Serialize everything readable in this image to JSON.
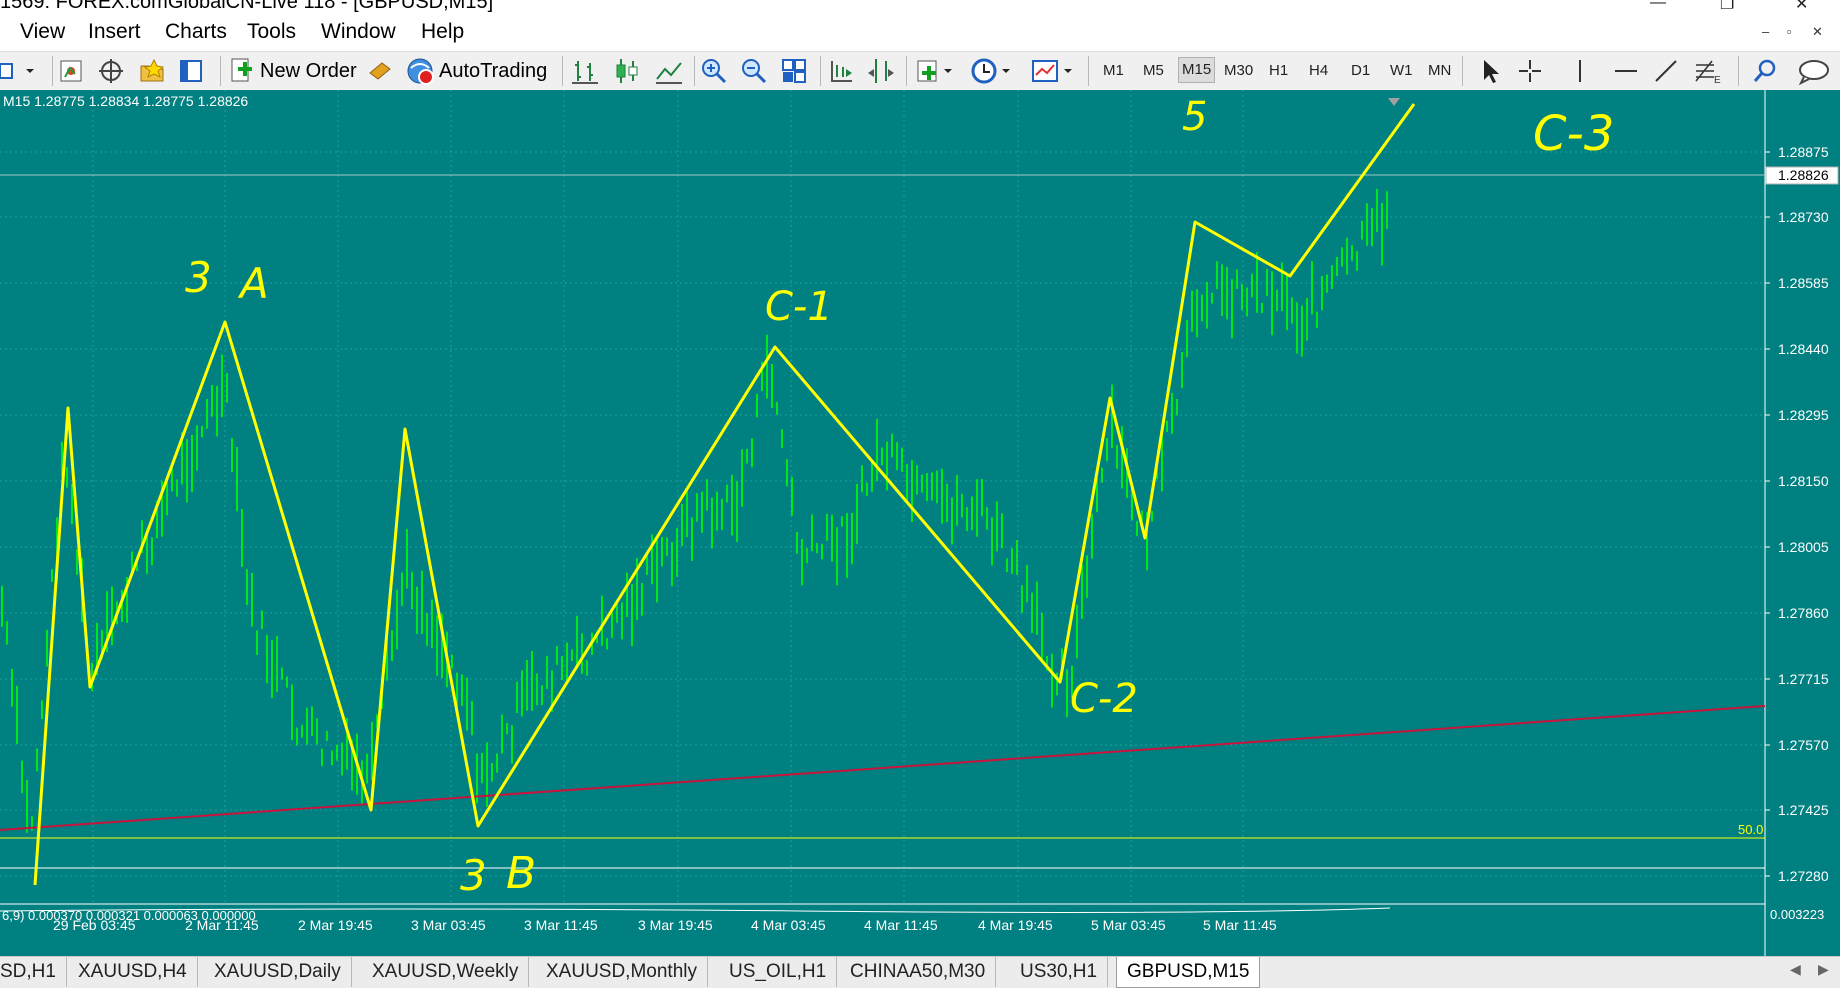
{
  "window": {
    "title": "1569: FOREX.comGlobalCN-Live 118 - [GBPUSD,M15]",
    "controls": [
      "—",
      "❐",
      "✕"
    ],
    "mdi_controls": [
      "–",
      "▫",
      "✕"
    ]
  },
  "menu": [
    "View",
    "Insert",
    "Charts",
    "Tools",
    "Window",
    "Help"
  ],
  "toolbar": {
    "new_order": "New Order",
    "autotrading": "AutoTrading",
    "timeframes": [
      "M1",
      "M5",
      "M15",
      "M30",
      "H1",
      "H4",
      "D1",
      "W1",
      "MN"
    ],
    "active_timeframe": "M15"
  },
  "chart": {
    "info_line": "M15  1.28775 1.28834 1.28775 1.28826",
    "background_color": "#008080",
    "candle_color": "#00ff00",
    "annotation_color": "#ffff00",
    "trendline_color": "#c8143c",
    "price_ticks": [
      "1.28875",
      "1.28730",
      "1.28585",
      "1.28440",
      "1.28295",
      "1.28150",
      "1.28005",
      "1.27860",
      "1.27715",
      "1.27570",
      "1.27425",
      "1.27280"
    ],
    "current_price": "1.28826",
    "level_label": "50.0",
    "time_ticks": [
      "29 Feb 03:45",
      "2 Mar 11:45",
      "2 Mar 19:45",
      "3 Mar 03:45",
      "3 Mar 11:45",
      "3 Mar 19:45",
      "4 Mar 03:45",
      "4 Mar 11:45",
      "4 Mar 19:45",
      "5 Mar 03:45",
      "5 Mar 11:45"
    ],
    "indicator_text": "6,9) 0.000370 0.000321 0.000063 0.000000",
    "indicator_scale_text": "0.003223",
    "handwritten_labels": [
      "3",
      "A",
      "C-1",
      "3",
      "B",
      "C-2",
      "5",
      "C-3"
    ]
  },
  "tabs": [
    "SD,H1",
    "XAUUSD,H4",
    "XAUUSD,Daily",
    "XAUUSD,Weekly",
    "XAUUSD,Monthly",
    "US_OIL,H1",
    "CHINAA50,M30",
    "US30,H1",
    "GBPUSD,M15"
  ],
  "active_tab": "GBPUSD,M15"
}
